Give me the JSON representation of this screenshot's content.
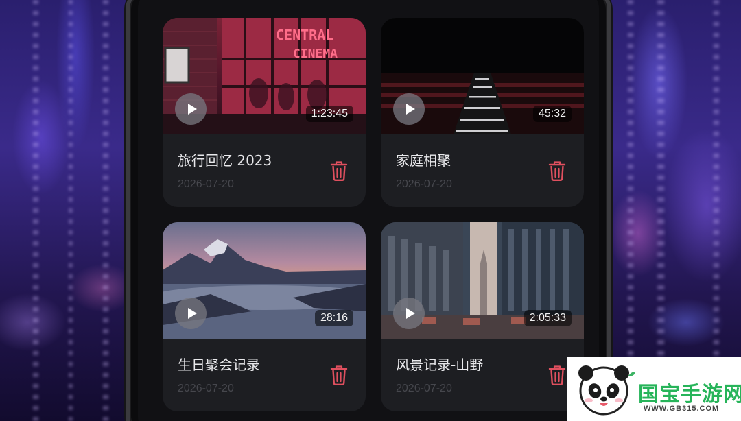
{
  "videos": [
    {
      "title": "旅行回忆 2023",
      "date": "2026-07-20",
      "duration": "1:23:45",
      "thumbnail": "neon-cinema-night-scene"
    },
    {
      "title": "家庭相聚",
      "date": "2026-07-20",
      "duration": "45:32",
      "thumbnail": "dark-stairway-red-lights"
    },
    {
      "title": "生日聚会记录",
      "date": "2026-07-20",
      "duration": "28:16",
      "thumbnail": "mountains-above-clouds-sunset"
    },
    {
      "title": "风景记录-山野",
      "date": "2026-07-20",
      "duration": "2:05:33",
      "thumbnail": "city-street-skyscrapers"
    }
  ],
  "icons": {
    "play": "play-icon",
    "delete": "trash-icon"
  },
  "colors": {
    "card_bg": "#1d1e22",
    "screen_bg": "#111114",
    "delete_accent": "#e0505f",
    "title_text": "#e9e9ec",
    "date_text": "#46474d"
  },
  "watermark": {
    "text": "国宝手游网",
    "url": "WWW.GB315.COM"
  }
}
